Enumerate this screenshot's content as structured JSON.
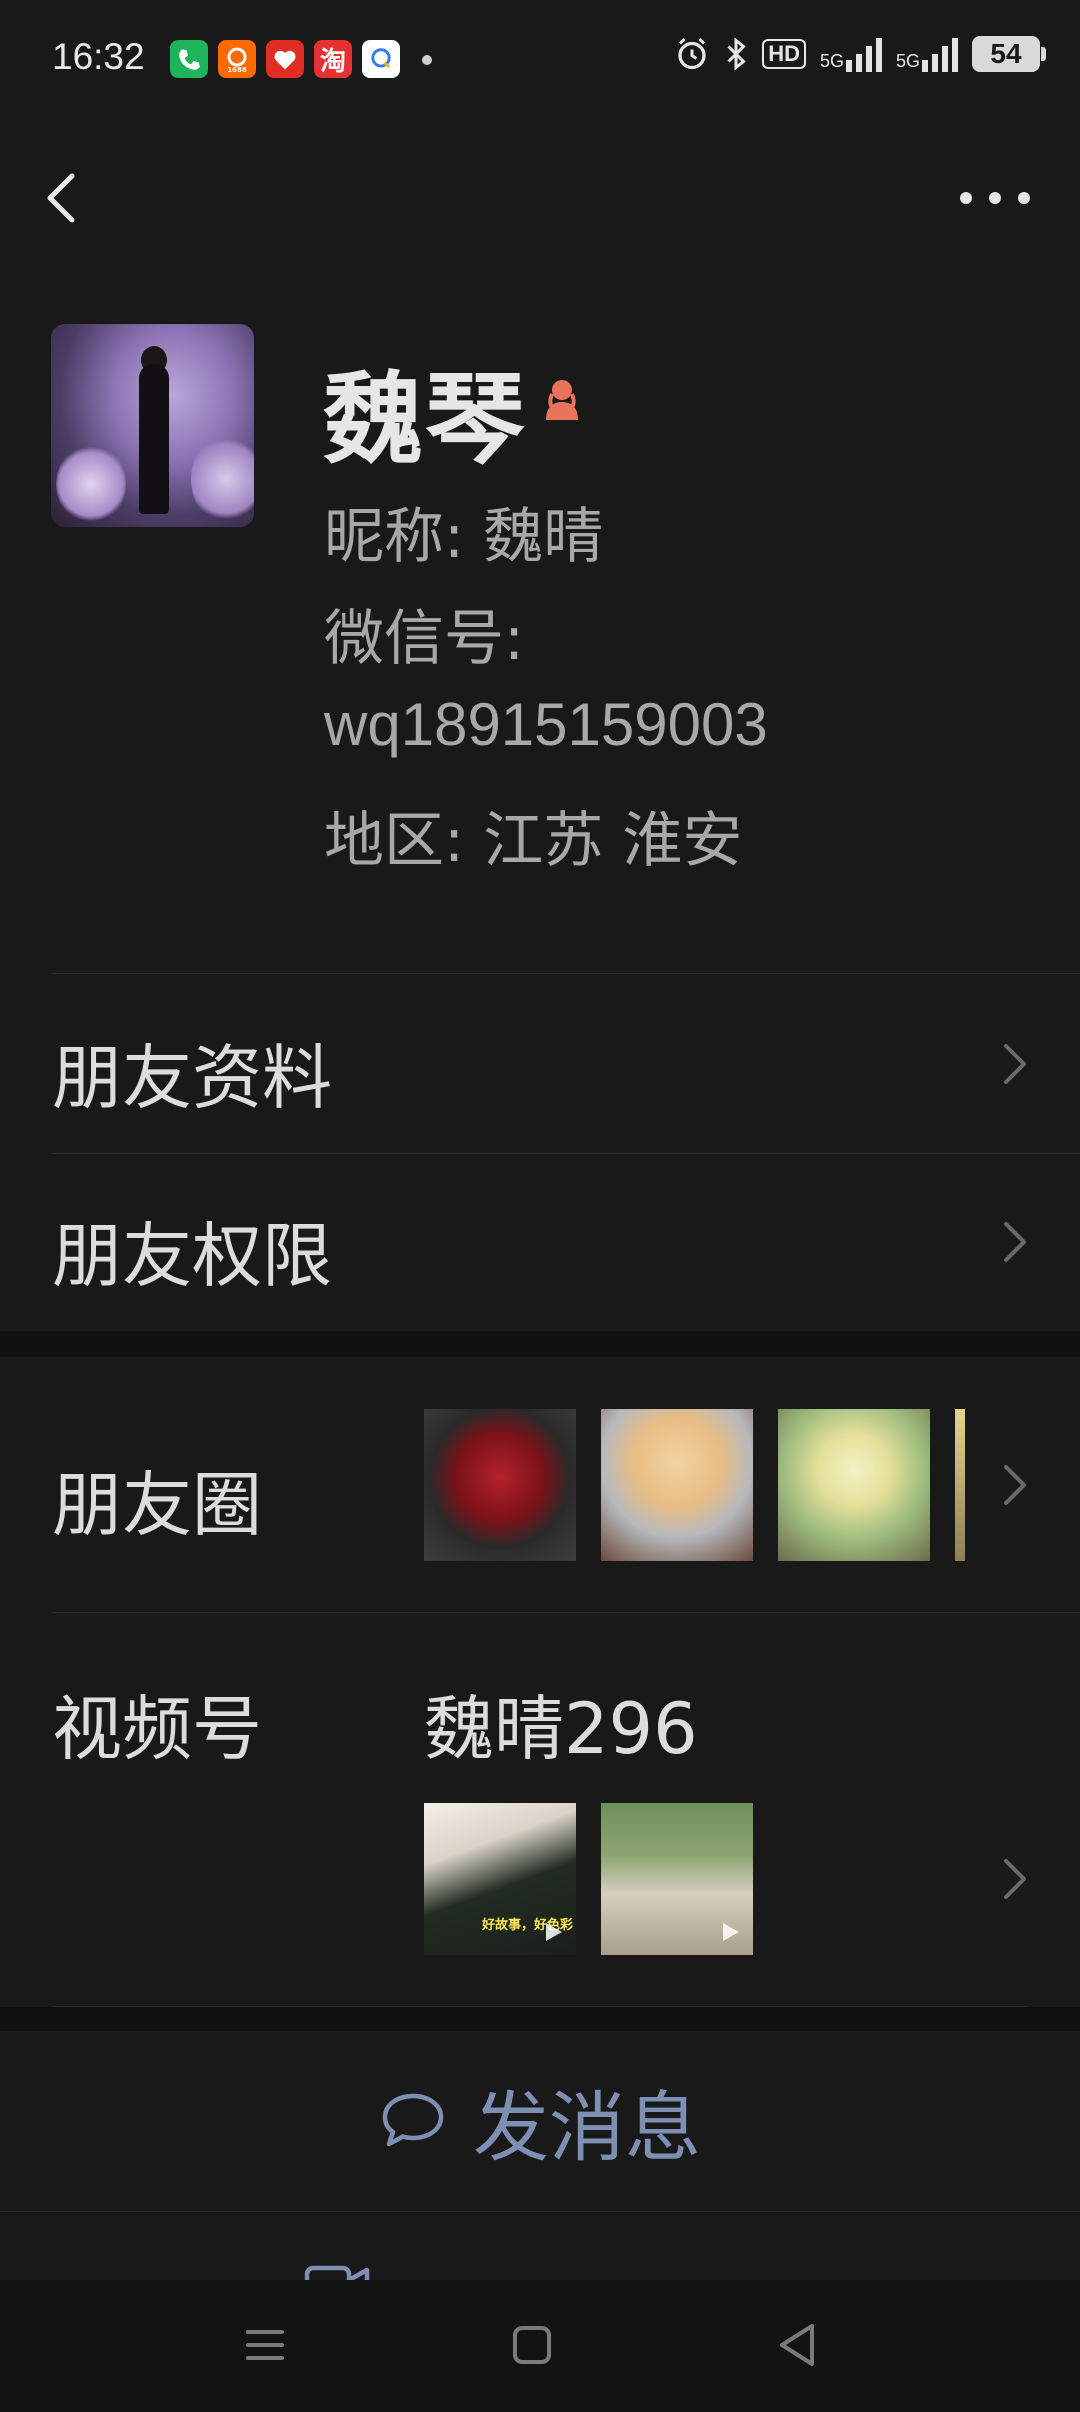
{
  "status_bar": {
    "time": "16:32",
    "apps": [
      {
        "icon": "phone-app-icon",
        "color": "#1fb35a",
        "glyph": "✆"
      },
      {
        "icon": "1688-app-icon",
        "color": "#ff6a00",
        "glyph": "1688"
      },
      {
        "icon": "pinduoduo-app-icon",
        "color": "#e02e24",
        "glyph": "❤"
      },
      {
        "icon": "taobao-app-icon",
        "color": "#e8302f",
        "glyph": "淘"
      },
      {
        "icon": "qq-app-icon",
        "color": "#ffffff",
        "glyph": "Q"
      }
    ],
    "network_1": "5G",
    "network_2": "5G",
    "hd": "HD",
    "battery": "54"
  },
  "profile": {
    "name": "魏琴",
    "gender": "female",
    "gender_color": "#e8735a",
    "nickname": "昵称:  魏晴",
    "wechat_id_label": "微信号:",
    "wechat_id": "wq18915159003",
    "region": "地区:  江苏  淮安"
  },
  "menu": {
    "friend_info": "朋友资料",
    "friend_permissions": "朋友权限",
    "moments": "朋友圈",
    "channels": "视频号",
    "channels_name": "魏晴296",
    "video_caption": "好故事，好色彩"
  },
  "actions": {
    "send_message": "发消息",
    "video_call": "音视频通话"
  },
  "colors": {
    "background": "#191919",
    "accent_link": "#7d90b4"
  }
}
